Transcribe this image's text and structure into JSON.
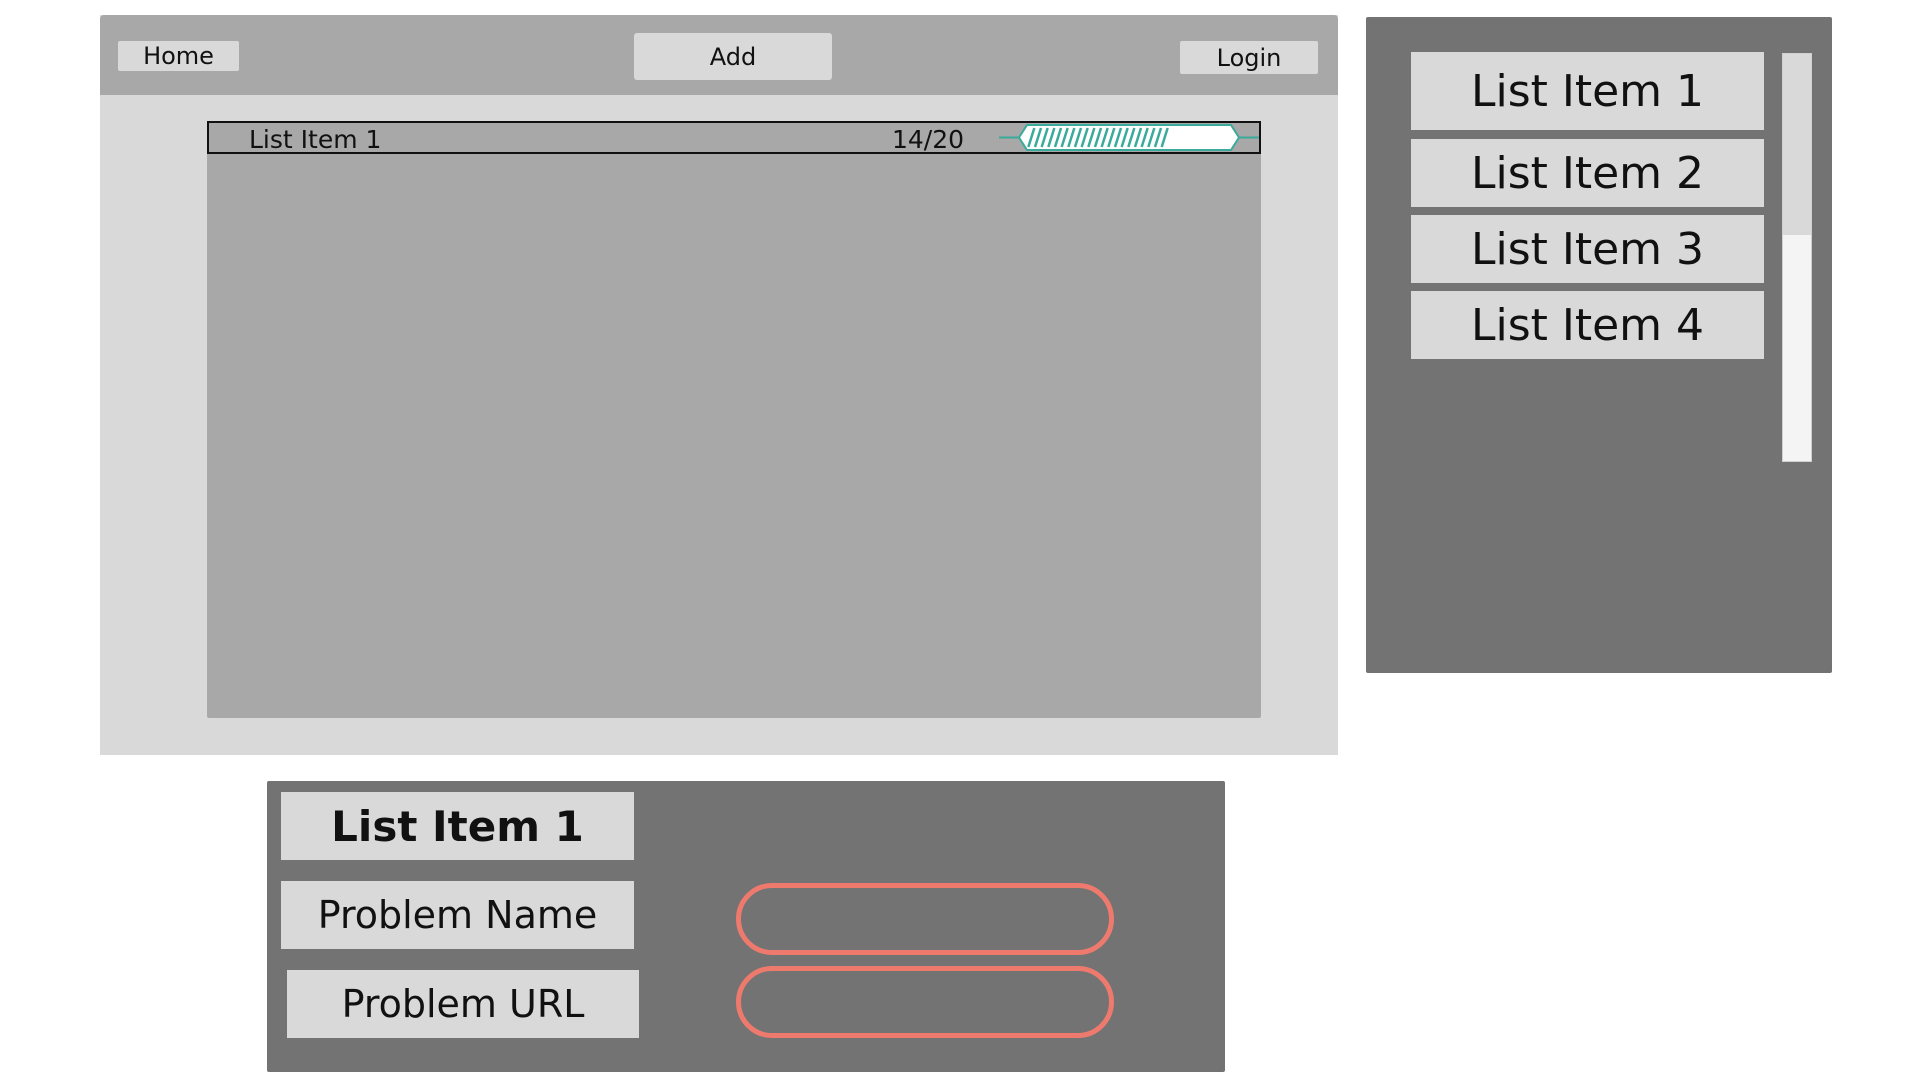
{
  "nav": {
    "home_label": "Home",
    "add_label": "Add",
    "login_label": "Login"
  },
  "main": {
    "row": {
      "title": "List Item 1",
      "count": "14/20",
      "progress": 0.7
    }
  },
  "sidebar": {
    "items": [
      {
        "label": "List Item 1"
      },
      {
        "label": "List Item 2"
      },
      {
        "label": "List Item 3"
      },
      {
        "label": "List Item 4"
      }
    ]
  },
  "form": {
    "title": "List Item 1",
    "problem_name_label": "Problem Name",
    "problem_url_label": "Problem URL",
    "problem_name_value": "",
    "problem_url_value": ""
  },
  "colors": {
    "dark_panel": "#737373",
    "mid_gray": "#a8a8a8",
    "light_gray": "#d9d9d9",
    "progress_accent": "#3aaa9a",
    "input_border": "#ee7a6e"
  }
}
